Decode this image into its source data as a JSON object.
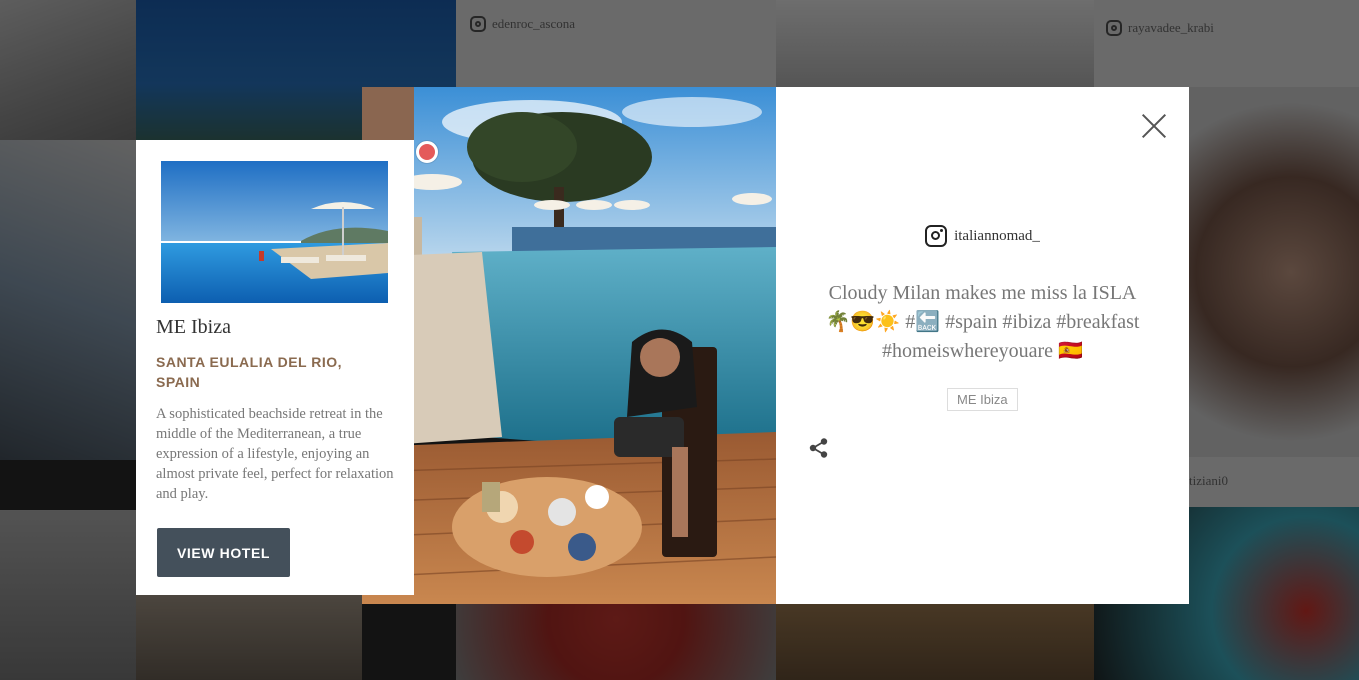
{
  "background": {
    "tiles": [
      {
        "handle": "edenroc_ascona"
      },
      {
        "handle": "rayavadee_krabi"
      },
      {
        "handle": "tiziani0"
      }
    ]
  },
  "modal": {
    "username": "italiannomad_",
    "caption_line1": "Cloudy Milan makes me miss la ISLA",
    "caption_line2": "🌴😎☀️ #🔙 #spain #ibiza #breakfast",
    "caption_line3": "#homeiswhereyouare 🇪🇸",
    "tag": "ME Ibiza",
    "icons": {
      "close": "close-icon",
      "share": "share-icon",
      "instagram": "instagram-icon"
    }
  },
  "hotel_card": {
    "name": "ME Ibiza",
    "location": "SANTA EULALIA DEL RIO, SPAIN",
    "description": "A sophisticated beachside retreat in the middle of the Mediterranean, a true expression of a lifestyle, enjoying an almost private feel, perfect for relaxation and play.",
    "button_label": "VIEW HOTEL"
  },
  "colors": {
    "button_bg": "#44505b",
    "location_text": "#8a6a4f",
    "hotspot": "#e45a5a"
  }
}
